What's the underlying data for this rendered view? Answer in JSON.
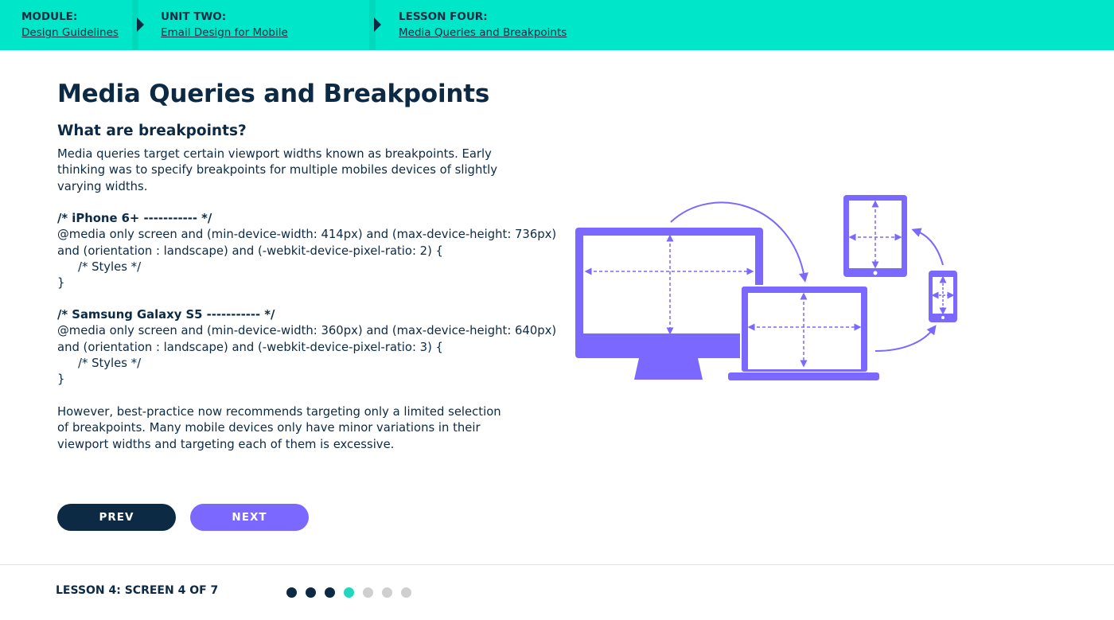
{
  "breadcrumb": {
    "module": {
      "title": "MODULE:",
      "link": "Design Guidelines"
    },
    "unit": {
      "title": "UNIT TWO:",
      "link": "Email Design for Mobile"
    },
    "lesson": {
      "title": "LESSON FOUR:",
      "link": "Media Queries and Breakpoints"
    }
  },
  "content": {
    "title": "Media Queries and Breakpoints",
    "subtitle": "What are breakpoints?",
    "intro": "Media queries target certain viewport widths known as breakpoints. Early thinking was to specify breakpoints for multiple mobiles devices of slightly varying widths.",
    "code": [
      {
        "comment": "/* iPhone 6+ ----------- */",
        "line1": "@media only screen and (min-device-width: 414px) and (max-device-height: 736px)",
        "line2": "and (orientation : landscape) and (-webkit-device-pixel-ratio: 2) {",
        "styles": "/* Styles */",
        "close": "}"
      },
      {
        "comment": "/* Samsung Galaxy S5 ----------- */",
        "line1": "@media only screen and (min-device-width: 360px) and (max-device-height: 640px)",
        "line2": "and (orientation : landscape) and (-webkit-device-pixel-ratio: 3) {",
        "styles": "/* Styles */",
        "close": "}"
      }
    ],
    "outro": "However, best-practice now recommends targeting only a limited selection of breakpoints. Many mobile devices only have minor variations in their viewport widths and targeting each of them is excessive."
  },
  "buttons": {
    "prev": "PREV",
    "next": "NEXT"
  },
  "footer": {
    "label": "LESSON 4: SCREEN 4 OF 7",
    "current_screen": 4,
    "total_screens": 7
  },
  "colors": {
    "header_bg": "#00e6c8",
    "navy": "#0d2a44",
    "accent_purple": "#7b68ff",
    "current_dot": "#1fd8bf"
  }
}
